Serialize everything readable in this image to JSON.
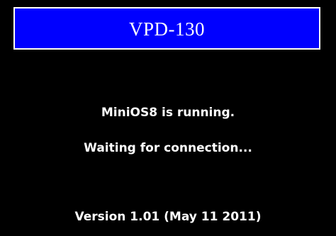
{
  "theme": {
    "background": "#000000",
    "title_bar_bg": "#0000ff",
    "title_bar_border": "#ffffff",
    "text_color": "#ffffff"
  },
  "header": {
    "title": "VPD-130"
  },
  "status": {
    "running": "MiniOS8 is running.",
    "waiting": "Waiting for connection..."
  },
  "footer": {
    "version": "Version 1.01 (May 11 2011)"
  }
}
